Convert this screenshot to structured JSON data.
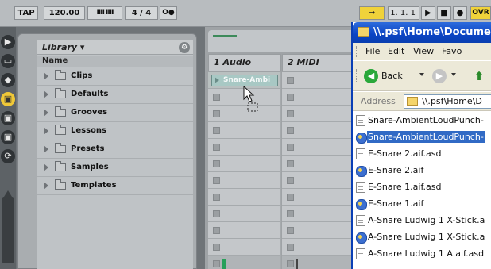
{
  "transport": {
    "tap": "TAP",
    "tempo": "120.00",
    "nudge": "IIII IIII",
    "time_signature": "4 / 4",
    "metronome": "O●",
    "follow": "→",
    "position": "1.  1.  1",
    "play": "▶",
    "stop": "■",
    "record": "●",
    "overdub": "OVR",
    "menu": "≡"
  },
  "browser": {
    "title": "Library ▾",
    "settings_icon": "gear-icon",
    "column_header": "Name",
    "folders": [
      {
        "label": "Clips"
      },
      {
        "label": "Defaults"
      },
      {
        "label": "Grooves"
      },
      {
        "label": "Lessons"
      },
      {
        "label": "Presets"
      },
      {
        "label": "Samples"
      },
      {
        "label": "Templates"
      }
    ]
  },
  "session": {
    "tracks": [
      {
        "name": "1 Audio"
      },
      {
        "name": "2 MIDI"
      }
    ],
    "clip_label": "Snare-Ambi"
  },
  "explorer": {
    "title": "\\\\.psf\\Home\\Docume",
    "menu": [
      "File",
      "Edit",
      "View",
      "Favo"
    ],
    "back_label": "Back",
    "address_label": "Address",
    "address_value": "\\\\.psf\\Home\\D",
    "files": [
      {
        "name": "Snare-AmbientLoudPunch-",
        "icon": "asd-file-icon",
        "selected": false
      },
      {
        "name": "Snare-AmbientLoudPunch-",
        "icon": "audio-file-icon",
        "selected": true
      },
      {
        "name": "E-Snare 2.aif.asd",
        "icon": "asd-file-icon",
        "selected": false
      },
      {
        "name": "E-Snare 2.aif",
        "icon": "audio-file-icon",
        "selected": false
      },
      {
        "name": "E-Snare 1.aif.asd",
        "icon": "asd-file-icon",
        "selected": false
      },
      {
        "name": "E-Snare 1.aif",
        "icon": "audio-file-icon",
        "selected": false
      },
      {
        "name": "A-Snare Ludwig 1 X-Stick.a",
        "icon": "asd-file-icon",
        "selected": false
      },
      {
        "name": "A-Snare Ludwig 1 X-Stick.a",
        "icon": "audio-file-icon",
        "selected": false
      },
      {
        "name": "A-Snare Ludwig 1 A.aif.asd",
        "icon": "asd-file-icon",
        "selected": false
      }
    ]
  },
  "colors": {
    "accent_yellow": "#f0d23a",
    "selection_blue": "#316ac5",
    "xp_title_blue": "#0b44c4",
    "clip_teal": "#a8c8c4"
  }
}
